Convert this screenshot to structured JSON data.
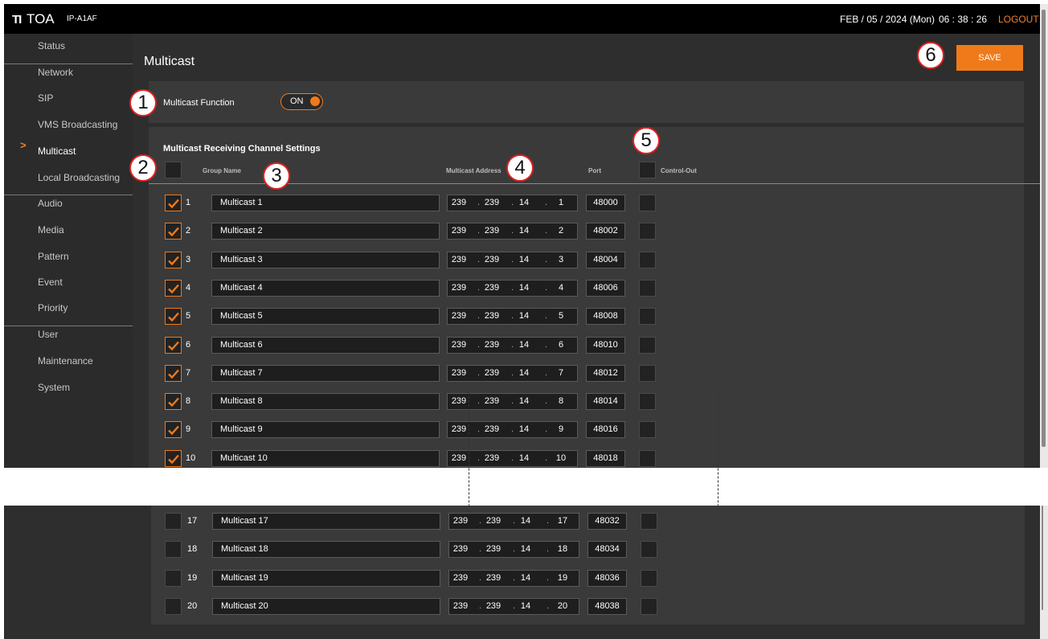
{
  "header": {
    "logo_mark": "TI",
    "logo_text": "TOA",
    "model": "IP-A1AF",
    "date": "FEB / 05 / 2024 (Mon)",
    "time": "06 : 38 : 26",
    "logout": "LOGOUT"
  },
  "sidebar": {
    "items": [
      {
        "label": "Status"
      },
      {
        "label": "Network"
      },
      {
        "label": "SIP"
      },
      {
        "label": "VMS Broadcasting"
      },
      {
        "label": "Multicast",
        "active": true
      },
      {
        "label": "Local Broadcasting"
      },
      {
        "label": "Audio"
      },
      {
        "label": "Media"
      },
      {
        "label": "Pattern"
      },
      {
        "label": "Event"
      },
      {
        "label": "Priority"
      },
      {
        "label": "User"
      },
      {
        "label": "Maintenance"
      },
      {
        "label": "System"
      }
    ],
    "active_arrow": ">"
  },
  "main": {
    "title": "Multicast",
    "save_label": "SAVE",
    "function_label": "Multicast Function",
    "function_toggle": "ON",
    "section_title": "Multicast Receiving Channel Settings",
    "columns": {
      "group_name": "Group Name",
      "address": "Multicast Address",
      "port": "Port",
      "control_out": "Control-Out"
    }
  },
  "rows_top": [
    {
      "num": "1",
      "checked": true,
      "name": "Multicast 1",
      "ip": [
        "239",
        "239",
        "14",
        "1"
      ],
      "port": "48000"
    },
    {
      "num": "2",
      "checked": true,
      "name": "Multicast 2",
      "ip": [
        "239",
        "239",
        "14",
        "2"
      ],
      "port": "48002"
    },
    {
      "num": "3",
      "checked": true,
      "name": "Multicast 3",
      "ip": [
        "239",
        "239",
        "14",
        "3"
      ],
      "port": "48004"
    },
    {
      "num": "4",
      "checked": true,
      "name": "Multicast 4",
      "ip": [
        "239",
        "239",
        "14",
        "4"
      ],
      "port": "48006"
    },
    {
      "num": "5",
      "checked": true,
      "name": "Multicast 5",
      "ip": [
        "239",
        "239",
        "14",
        "5"
      ],
      "port": "48008"
    },
    {
      "num": "6",
      "checked": true,
      "name": "Multicast 6",
      "ip": [
        "239",
        "239",
        "14",
        "6"
      ],
      "port": "48010"
    },
    {
      "num": "7",
      "checked": true,
      "name": "Multicast 7",
      "ip": [
        "239",
        "239",
        "14",
        "7"
      ],
      "port": "48012"
    },
    {
      "num": "8",
      "checked": true,
      "name": "Multicast 8",
      "ip": [
        "239",
        "239",
        "14",
        "8"
      ],
      "port": "48014"
    },
    {
      "num": "9",
      "checked": true,
      "name": "Multicast 9",
      "ip": [
        "239",
        "239",
        "14",
        "9"
      ],
      "port": "48016"
    },
    {
      "num": "10",
      "checked": true,
      "name": "Multicast 10",
      "ip": [
        "239",
        "239",
        "14",
        "10"
      ],
      "port": "48018"
    }
  ],
  "rows_bottom": [
    {
      "num": "17",
      "checked": false,
      "name": "Multicast 17",
      "ip": [
        "239",
        "239",
        "14",
        "17"
      ],
      "port": "48032"
    },
    {
      "num": "18",
      "checked": false,
      "name": "Multicast 18",
      "ip": [
        "239",
        "239",
        "14",
        "18"
      ],
      "port": "48034"
    },
    {
      "num": "19",
      "checked": false,
      "name": "Multicast 19",
      "ip": [
        "239",
        "239",
        "14",
        "19"
      ],
      "port": "48036"
    },
    {
      "num": "20",
      "checked": false,
      "name": "Multicast 20",
      "ip": [
        "239",
        "239",
        "14",
        "20"
      ],
      "port": "48038"
    }
  ],
  "ip_separator": ".",
  "markers": [
    "1",
    "2",
    "3",
    "4",
    "5",
    "6"
  ],
  "colors": {
    "accent": "#f07a1a",
    "background": "#2e2e2e",
    "panel": "#3a3a3a",
    "topbar": "#000000",
    "marker_border": "#e02020"
  }
}
